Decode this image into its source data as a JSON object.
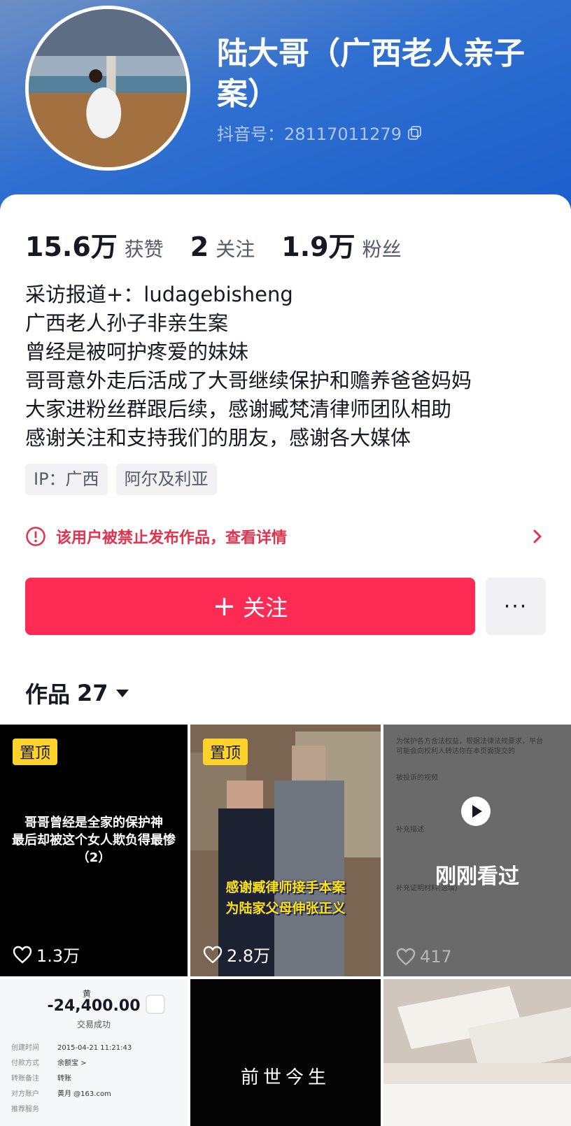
{
  "profile": {
    "nickname": "陆大哥（广西老人亲子案）",
    "douyin_id": "抖音号：28117011279"
  },
  "stats": [
    {
      "num": "15.6万",
      "label": "获赞"
    },
    {
      "num": "2",
      "label": "关注"
    },
    {
      "num": "1.9万",
      "label": "粉丝"
    }
  ],
  "bio": [
    "采访报道+：ludagebisheng",
    "广西老人孙子非亲生案",
    "曾经是被呵护疼爱的妹妹",
    "哥哥意外走后活成了大哥继续保护和赡养爸爸妈妈",
    "大家进粉丝群跟后续，感谢臧梵清律师团队相助",
    "感谢关注和支持我们的朋友，感谢各大媒体"
  ],
  "tags": [
    "IP：广西",
    "阿尔及利亚"
  ],
  "ban_notice": "该用户被禁止发布作品，查看详情",
  "actions": {
    "follow_label": "关注",
    "more_label": "···"
  },
  "works": {
    "label": "作品",
    "count": "27"
  },
  "videos": [
    {
      "pin": "置顶",
      "caption": [
        "哥哥曾经是全家的保护神",
        "最后却被这个女人欺负得最惨",
        "（2）"
      ],
      "likes": "1.3万"
    },
    {
      "pin": "置顶",
      "caption": [
        "感谢臧律师接手本案",
        "为陆家父母伸张正义"
      ],
      "likes": "2.8万"
    },
    {
      "overlay_label": "刚刚看过",
      "likes": "417",
      "doc_lines": [
        "为保护各方合法权益，根据法律法规要求，平台",
        "可能会向权利人转达你在本页面提交的",
        "被投诉的视频",
        "补充描述",
        "补充证明材料(选填)"
      ]
    },
    {
      "receipt": {
        "name": "黄",
        "amount": "-24,400.00",
        "status": "交易成功",
        "rows": [
          {
            "k": "创建时间",
            "v": "2015-04-21 11:21:43"
          },
          {
            "k": "付款方式",
            "v": "余额宝 >"
          },
          {
            "k": "转账备注",
            "v": "转账"
          },
          {
            "k": "对方账户",
            "v": "黄月 @163.com"
          },
          {
            "k": "推荐服务",
            "v": ""
          }
        ]
      }
    },
    {
      "text": "前世今生"
    },
    {}
  ],
  "colors": {
    "accent": "#fe2c55",
    "header": "#2f6fd0",
    "pin": "#fdd22a",
    "warning": "#e3324d"
  }
}
